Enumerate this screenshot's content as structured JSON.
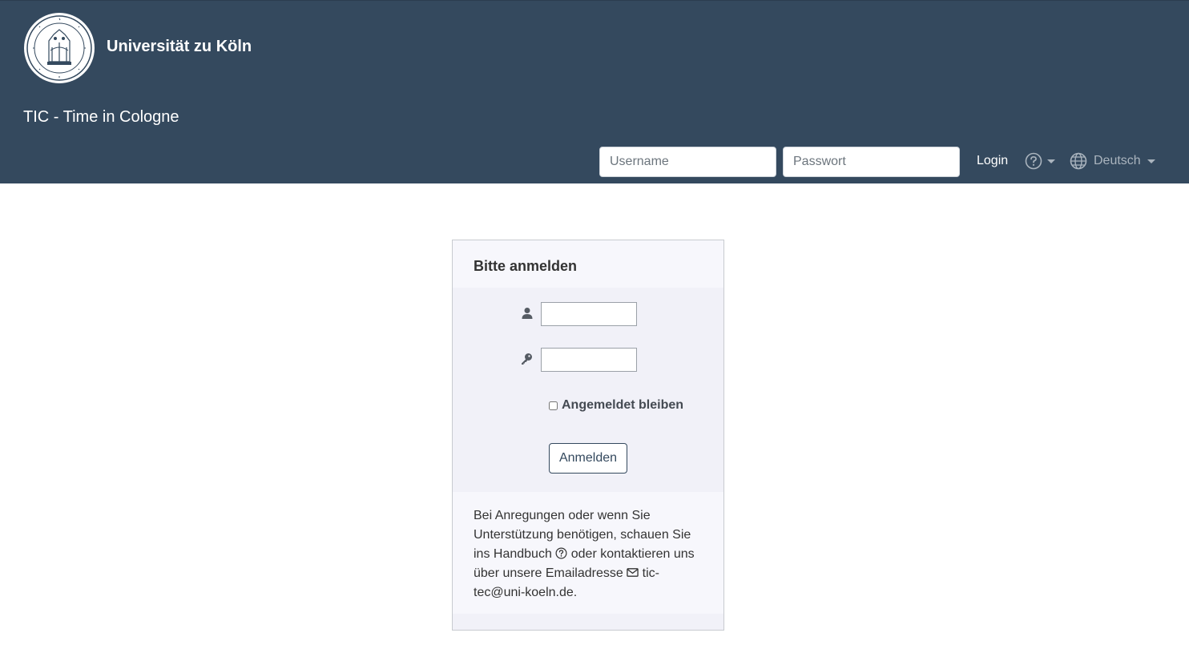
{
  "header": {
    "university": "Universität zu Köln",
    "app_title": "TIC - Time in Cologne",
    "username_placeholder": "Username",
    "password_placeholder": "Passwort",
    "login_label": "Login",
    "language_label": "Deutsch"
  },
  "card": {
    "title": "Bitte anmelden",
    "remember_label": "Angemeldet bleiben",
    "submit_label": "Anmelden",
    "footer": {
      "part1": "Bei Anregungen oder wenn Sie Unterstützung benötigen, schauen Sie ins Handbuch",
      "part2": "oder kontaktieren uns über unsere Emailadresse",
      "email": "tic-tec@uni-koeln.de",
      "end": "."
    }
  },
  "icons": {
    "help": "question-circle-icon",
    "language": "globe-icon",
    "user": "user-icon",
    "password": "key-icon",
    "manual": "question-circle-icon",
    "email": "envelope-icon"
  },
  "colors": {
    "header_bg": "#34495e",
    "card_bg": "#f1f1f8",
    "card_section_bg": "#f7f7fc"
  }
}
